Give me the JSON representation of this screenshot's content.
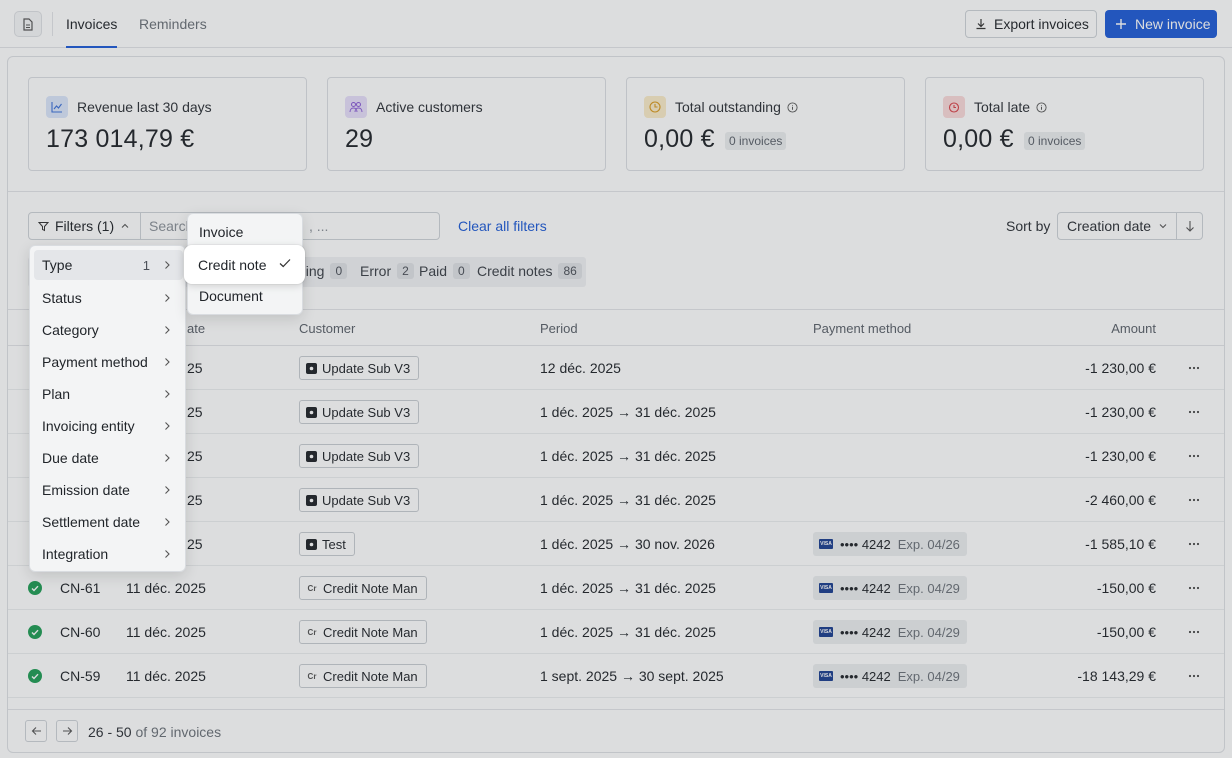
{
  "topbar": {
    "tabs": [
      "Invoices",
      "Reminders"
    ],
    "export_label": "Export invoices",
    "new_label": "New invoice",
    "accent": "#1e5bd7"
  },
  "cards": [
    {
      "title": "Revenue last 30 days",
      "value": "173 014,79 €",
      "icon": "chart-line-icon",
      "icon_color": "#3b6fd8",
      "badge": ""
    },
    {
      "title": "Active customers",
      "value": "29",
      "icon": "users-icon",
      "icon_color": "#8a5cd6",
      "badge": ""
    },
    {
      "title": "Total outstanding",
      "value": "0,00 €",
      "icon": "clock-icon",
      "icon_color": "#d99a1e",
      "badge": "0 invoices"
    },
    {
      "title": "Total late",
      "value": "0,00 €",
      "icon": "alarm-icon",
      "icon_color": "#d9434a",
      "badge": "0 invoices"
    }
  ],
  "filters": {
    "button_label": "Filters (1)",
    "search_placeholder": "Search",
    "search_suffix": ", ...",
    "clear_label": "Clear all filters",
    "sort_label": "Sort by",
    "sort_value": "Creation date"
  },
  "status_strip": [
    {
      "label": "ding",
      "count": "0"
    },
    {
      "label": "Error",
      "count": "2"
    },
    {
      "label": "Paid",
      "count": "0"
    },
    {
      "label": "Credit notes",
      "count": "86"
    }
  ],
  "table": {
    "headers": {
      "date": "ate",
      "customer": "Customer",
      "period": "Period",
      "payment": "Payment method",
      "amount": "Amount"
    },
    "rows": [
      {
        "number": "",
        "date": "25",
        "customer": "Update Sub V3",
        "cust_icon": "dark",
        "period": "12 déc. 2025",
        "card": "",
        "exp": "",
        "amount": "-1 230,00 €"
      },
      {
        "number": "",
        "date": "25",
        "customer": "Update Sub V3",
        "cust_icon": "dark",
        "period": "1 déc. 2025 → 31 déc. 2025",
        "card": "",
        "exp": "",
        "amount": "-1 230,00 €"
      },
      {
        "number": "",
        "date": "25",
        "customer": "Update Sub V3",
        "cust_icon": "dark",
        "period": "1 déc. 2025 → 31 déc. 2025",
        "card": "",
        "exp": "",
        "amount": "-1 230,00 €"
      },
      {
        "number": "",
        "date": "25",
        "customer": "Update Sub V3",
        "cust_icon": "dark",
        "period": "1 déc. 2025 → 31 déc. 2025",
        "card": "",
        "exp": "",
        "amount": "-2 460,00 €"
      },
      {
        "number": "",
        "date": "25",
        "customer": "Test",
        "cust_icon": "dark",
        "period": "1 déc. 2025 → 30 nov. 2026",
        "card": "•••• 4242",
        "exp": "Exp. 04/26",
        "amount": "-1 585,10 €"
      },
      {
        "number": "CN-61",
        "date": "11 déc. 2025",
        "customer": "Credit Note Man",
        "cust_icon": "cr",
        "period": "1 déc. 2025 → 31 déc. 2025",
        "card": "•••• 4242",
        "exp": "Exp. 04/29",
        "amount": "-150,00 €"
      },
      {
        "number": "CN-60",
        "date": "11 déc. 2025",
        "customer": "Credit Note Man",
        "cust_icon": "cr",
        "period": "1 déc. 2025 → 31 déc. 2025",
        "card": "•••• 4242",
        "exp": "Exp. 04/29",
        "amount": "-150,00 €"
      },
      {
        "number": "CN-59",
        "date": "11 déc. 2025",
        "customer": "Credit Note Man",
        "cust_icon": "cr",
        "period": "1 sept. 2025 → 30 sept. 2025",
        "card": "•••• 4242",
        "exp": "Exp. 04/29",
        "amount": "-18 143,29 €"
      }
    ]
  },
  "pagination": {
    "range": "26 - 50",
    "of_text": "of 92 invoices"
  },
  "filter_menu": {
    "items": [
      "Type",
      "Status",
      "Category",
      "Payment method",
      "Plan",
      "Invoicing entity",
      "Due date",
      "Emission date",
      "Settlement date",
      "Integration"
    ],
    "type_count": "1"
  },
  "type_menu": {
    "items": [
      "Invoice",
      "Credit note",
      "Document"
    ],
    "selected": "Credit note"
  }
}
